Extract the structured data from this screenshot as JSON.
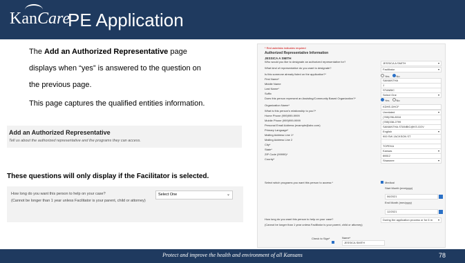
{
  "header": {
    "logo_main": "Kan",
    "logo_care": "Care",
    "title": "PE Application"
  },
  "slide": {
    "para1_prefix": "The ",
    "para1_bold": "Add an Authorized Representative",
    "para1_suffix": " page",
    "para1_line2": "displays when “yes” is answered to the question on",
    "para1_line3": "the previous page.",
    "para2": "This page captures the qualified entities information.",
    "section_heading": "Add an Authorized Representative",
    "section_sub": "Tell us about the authorized representative and the programs they can access.",
    "note": "These questions will only display if the Facilitator is selected.",
    "question": "How long do you want this person to help on your case?",
    "question_note": "(Cannot be longer than 1 year unless Facilitator is your parent, child or attorney)",
    "select_value": "Select One"
  },
  "form": {
    "required_note": "* Red asterisks indicates required",
    "heading": "Authorized Representative Information",
    "person": "JESSICA A SMITH",
    "rows": [
      {
        "label": "Who would you like to designate an authorized representative for?",
        "value": "JESSICA A SMITH",
        "dropdown": true
      },
      {
        "label": "What kind of representative do you want to designate?",
        "value": "Facilitator",
        "dropdown": true
      },
      {
        "label": "Is this someone already listed on the application?*",
        "radio": [
          "Yes",
          "No"
        ],
        "selected": "No"
      },
      {
        "label": "First Name*",
        "value": "SAMANTHA"
      },
      {
        "label": "Middle Name",
        "value": "J"
      },
      {
        "label": "Last Name*",
        "value": "STANBIC"
      },
      {
        "label": "Suffix",
        "value": "Select One",
        "dropdown": true
      },
      {
        "label": "Does this person represent an Assisting/Community Based Organization?*",
        "radio": [
          "Yes",
          "No"
        ],
        "selected": "Yes"
      },
      {
        "label": "Organization Name*",
        "value": "KDHE-DHCF"
      },
      {
        "label": "What is this person's relationship to you?*",
        "value": "Unrelated",
        "dropdown": true
      },
      {
        "label": "Home Phone (999)999-9999",
        "value": "(785)296-8016"
      },
      {
        "label": "Mobile Phone (999)999-9999",
        "value": "(785)338-2799"
      },
      {
        "label": "Personal Email Address (example@abc.com)",
        "value": "SAMANTHA.STANBIC@KS.GOV"
      },
      {
        "label": "Primary Language*",
        "value": "English",
        "dropdown": true
      },
      {
        "label": "Mailing Address Line 1*",
        "value": "900 SW JACKSON ST"
      },
      {
        "label": "Mailing Address Line 2",
        "value": ""
      },
      {
        "label": "City*",
        "value": "TOPEKA"
      },
      {
        "label": "State*",
        "value": "Kansas",
        "dropdown": true
      },
      {
        "label": "ZIP Code (99999)*",
        "value": "66612"
      },
      {
        "label": "County*",
        "value": "Shawnee",
        "dropdown": true
      }
    ],
    "programs_label": "Select which programs you want this person to access:*",
    "program": "Medical",
    "start_label": "Start Month (mm/yyyy)",
    "start_value": "06/2021",
    "end_label": "End Month (mm/yyyy)",
    "end_value": "12/2021",
    "how_long_label": "How long do you want this person to help on your case?",
    "how_long_value": "During the application process or for 6 m",
    "how_long_note": "(Cannot be longer than 1 year unless Facilitator is your parent, child or attorney)",
    "sign_label": "Check to Sign*",
    "name_label": "Name*",
    "name_value": "JESSICA SMITH"
  },
  "footer": {
    "tagline": "Protect and improve the health and environment of all Kansans",
    "page": "78"
  }
}
